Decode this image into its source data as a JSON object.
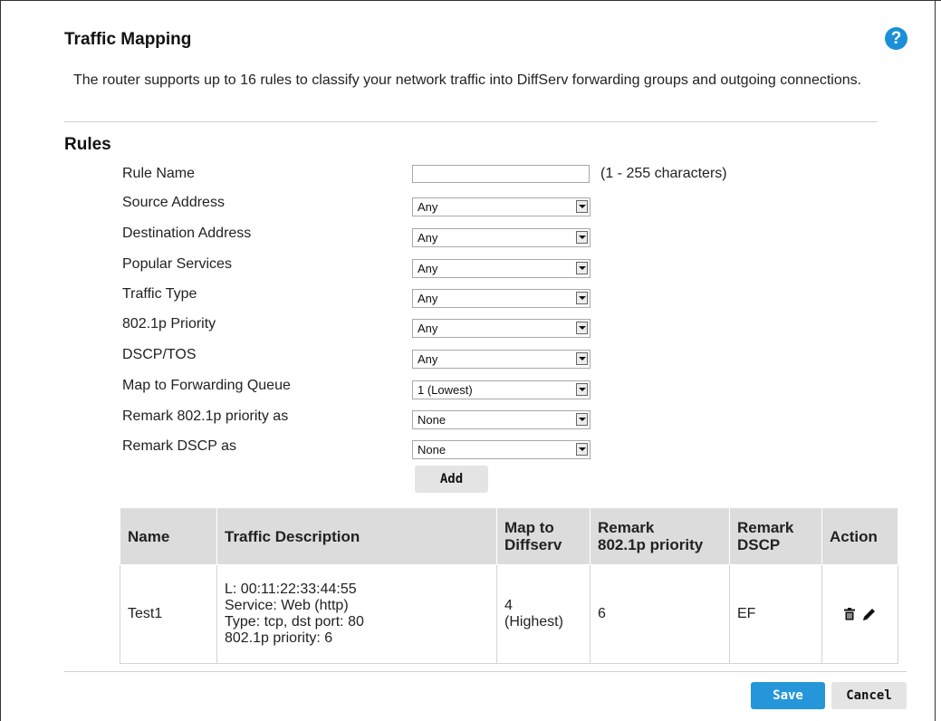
{
  "page": {
    "title": "Traffic Mapping",
    "help_icon": "question-circle-icon",
    "description": "The router supports up to 16 rules to classify your network traffic into DiffServ forwarding groups and outgoing connections."
  },
  "rules": {
    "heading": "Rules",
    "rule_name": {
      "label": "Rule Name",
      "value": "",
      "hint": "(1 - 255 characters)"
    },
    "fields": [
      {
        "label": "Source Address",
        "value": "Any"
      },
      {
        "label": "Destination Address",
        "value": "Any"
      },
      {
        "label": "Popular Services",
        "value": "Any"
      },
      {
        "label": "Traffic Type",
        "value": "Any"
      },
      {
        "label": "802.1p Priority",
        "value": "Any"
      },
      {
        "label": "DSCP/TOS",
        "value": "Any"
      },
      {
        "label": "Map to Forwarding Queue",
        "value": "1 (Lowest)"
      },
      {
        "label": "Remark 802.1p priority as",
        "value": "None"
      },
      {
        "label": "Remark DSCP as",
        "value": "None"
      }
    ],
    "add_label": "Add"
  },
  "table": {
    "headers": {
      "name": "Name",
      "traffic_description": "Traffic Description",
      "map_line1": "Map to",
      "map_line2": "Diffserv",
      "remark_priority_line1": "Remark",
      "remark_priority_line2": "802.1p priority",
      "remark_dscp_line1": "Remark",
      "remark_dscp_line2": "DSCP",
      "action": "Action"
    },
    "rows": [
      {
        "name": "Test1",
        "desc_line1": "L: 00:11:22:33:44:55",
        "desc_line2": "Service: Web (http)",
        "desc_line3": "Type: tcp, dst port: 80",
        "desc_line4": "802.1p priority: 6",
        "map_line1": "4",
        "map_line2": "(Highest)",
        "remark_priority": "6",
        "remark_dscp": "EF",
        "actions": [
          "trash-icon",
          "pencil-icon"
        ]
      }
    ]
  },
  "footer": {
    "save_label": "Save",
    "cancel_label": "Cancel"
  },
  "colors": {
    "accent": "#2596d9",
    "help_icon": "#1a8fd8",
    "header_bg": "#dcdcdc",
    "button_bg": "#e4e4e4"
  }
}
